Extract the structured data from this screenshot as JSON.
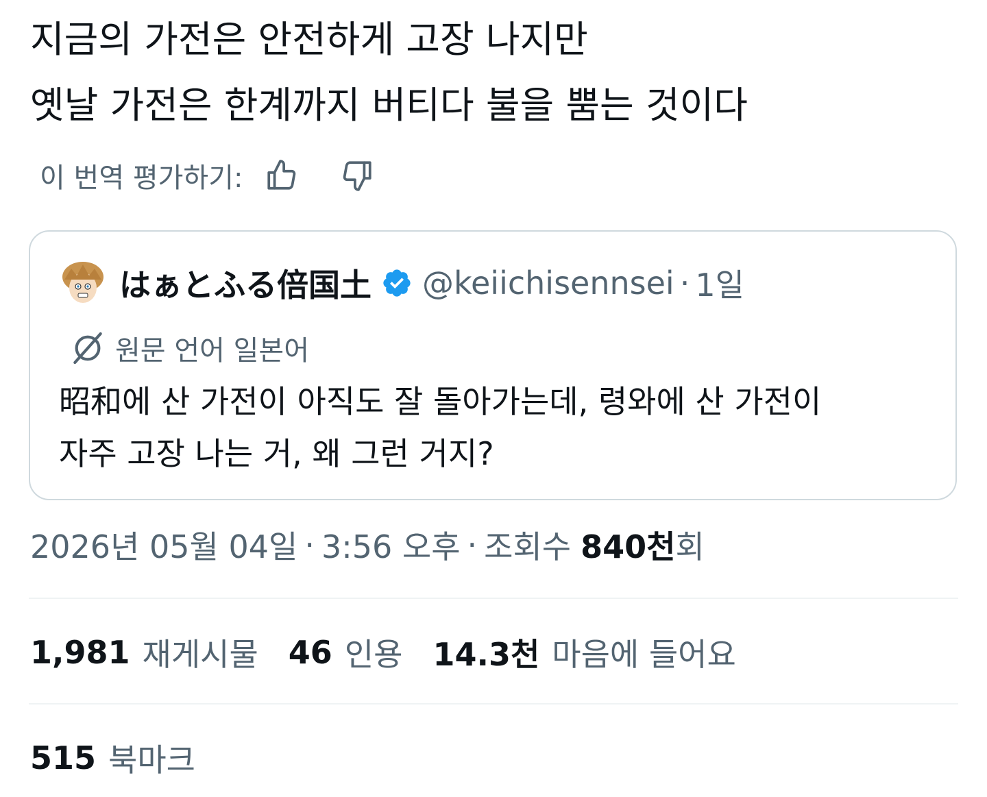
{
  "tweet": {
    "lines": [
      "지금의 가전은 안전하게 고장 나지만",
      "옛날 가전은 한계까지 버티다 불을 뿜는 것이다"
    ]
  },
  "rating": {
    "label": "이 번역 평가하기:",
    "thumbs_up_icon": "thumbs-up-icon",
    "thumbs_down_icon": "thumbs-down-icon"
  },
  "quote": {
    "display_name": "はぁとふる倍国土",
    "handle": "@keiichisennsei",
    "separator": "·",
    "time_ago": "1일",
    "original_language": "원문 언어 일본어",
    "lines": [
      "昭和에 산 가전이 아직도 잘 돌아가는데, 령와에 산 가전이",
      "자주 고장 나는 거, 왜 그런 거지?"
    ],
    "verified_color": "#1d9bf0"
  },
  "meta": {
    "date": "2026년 05월 04일",
    "sep1": "·",
    "time": "3:56 오후",
    "sep2": "·",
    "views_label": "조회수",
    "views_value": "840천",
    "views_suffix": "회"
  },
  "stats": {
    "reposts_value": "1,981",
    "reposts_label": "재게시물",
    "quotes_value": "46",
    "quotes_label": "인용",
    "likes_value": "14.3천",
    "likes_label": "마음에 들어요",
    "bookmarks_value": "515",
    "bookmarks_label": "북마크"
  },
  "colors": {
    "text_primary": "#0f1419",
    "text_secondary": "#536471",
    "border": "#cfd9de",
    "divider": "#eff3f4",
    "verified": "#1d9bf0"
  }
}
